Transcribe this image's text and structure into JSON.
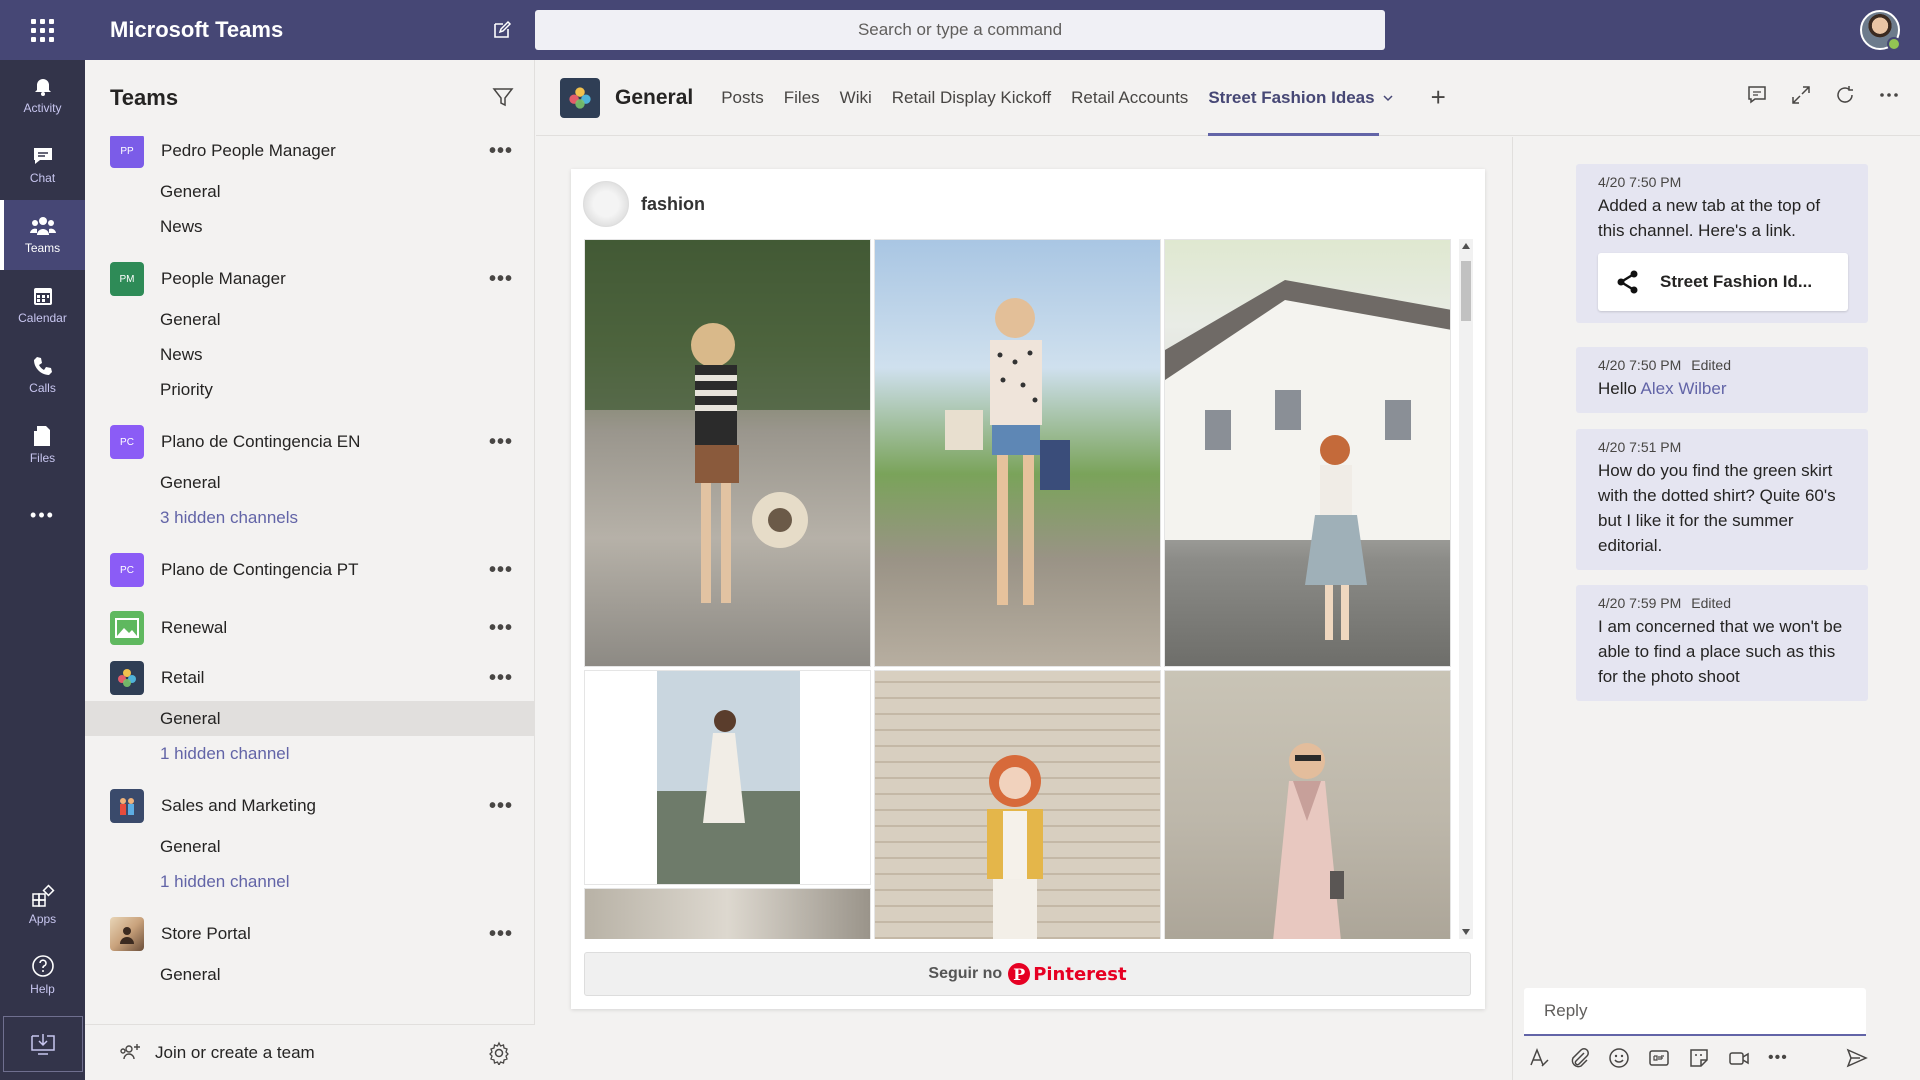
{
  "app": {
    "title": "Microsoft Teams",
    "search_placeholder": "Search or type a command"
  },
  "rail": {
    "items": [
      {
        "label": "Activity",
        "icon": "bell-icon"
      },
      {
        "label": "Chat",
        "icon": "chat-icon"
      },
      {
        "label": "Teams",
        "icon": "teams-icon",
        "active": true
      },
      {
        "label": "Calendar",
        "icon": "calendar-icon"
      },
      {
        "label": "Calls",
        "icon": "phone-icon"
      },
      {
        "label": "Files",
        "icon": "files-icon"
      }
    ],
    "more_label": "•••",
    "bottom": [
      {
        "label": "Apps",
        "icon": "apps-icon"
      },
      {
        "label": "Help",
        "icon": "help-icon"
      }
    ]
  },
  "teams_panel": {
    "title": "Teams",
    "teams": [
      {
        "initials": "PP",
        "name": "Pedro People Manager",
        "color": "#7b5ce8",
        "channels": [
          {
            "label": "General"
          },
          {
            "label": "News"
          }
        ]
      },
      {
        "initials": "PM",
        "name": "People Manager",
        "color": "#2e8b57",
        "channels": [
          {
            "label": "General"
          },
          {
            "label": "News"
          },
          {
            "label": "Priority"
          }
        ]
      },
      {
        "initials": "PC",
        "name": "Plano de Contingencia EN",
        "color": "#8b5cf6",
        "channels": [
          {
            "label": "General"
          },
          {
            "label": "3 hidden channels",
            "hidden": true
          }
        ]
      },
      {
        "initials": "PC",
        "name": "Plano de Contingencia PT",
        "color": "#8b5cf6",
        "channels": []
      },
      {
        "initials": "",
        "name": "Renewal",
        "color": "#5fb85f",
        "channels": []
      },
      {
        "initials": "",
        "name": "Retail",
        "color": "#2f3e55",
        "channels": [
          {
            "label": "General",
            "selected": true
          },
          {
            "label": "1 hidden channel",
            "hidden": true
          }
        ]
      },
      {
        "initials": "",
        "name": "Sales and Marketing",
        "color": "#3a4a6b",
        "channels": [
          {
            "label": "General"
          },
          {
            "label": "1 hidden channel",
            "hidden": true
          }
        ]
      },
      {
        "initials": "",
        "name": "Store Portal",
        "color": "#c9a27c",
        "channels": [
          {
            "label": "General"
          }
        ]
      }
    ],
    "more_label": "•••",
    "footer_label": "Join or create a team"
  },
  "channel": {
    "name": "General",
    "tabs": [
      {
        "label": "Posts"
      },
      {
        "label": "Files"
      },
      {
        "label": "Wiki"
      },
      {
        "label": "Retail Display Kickoff"
      },
      {
        "label": "Retail Accounts"
      },
      {
        "label": "Street Fashion Ideas",
        "active": true
      }
    ],
    "add_tab": "+"
  },
  "pinterest": {
    "username": "fashion",
    "follow_prefix": "Seguir no",
    "follow_brand": "Pinterest",
    "logo_letter": "P"
  },
  "conversation": {
    "messages": [
      {
        "time": "4/20 7:50 PM",
        "edited": "",
        "text": "Added a new tab at the top of this channel. Here's a link.",
        "link_title": "Street Fashion Id..."
      },
      {
        "time": "4/20 7:50 PM",
        "edited": "Edited",
        "text_prefix": "Hello ",
        "mention": "Alex Wilber"
      },
      {
        "time": "4/20 7:51 PM",
        "edited": "",
        "text": "How do you find the green skirt with the dotted shirt? Quite 60's but I like it for the summer editorial."
      },
      {
        "time": "4/20 7:59 PM",
        "edited": "Edited",
        "text": "I am concerned that we won't be able to find a place such as this for the photo shoot"
      }
    ],
    "reply_placeholder": "Reply",
    "reply_more": "•••"
  },
  "colors": {
    "topbar": "#464775",
    "rail": "#33344a",
    "accent": "#6264a7",
    "pinterest_red": "#e60023"
  }
}
